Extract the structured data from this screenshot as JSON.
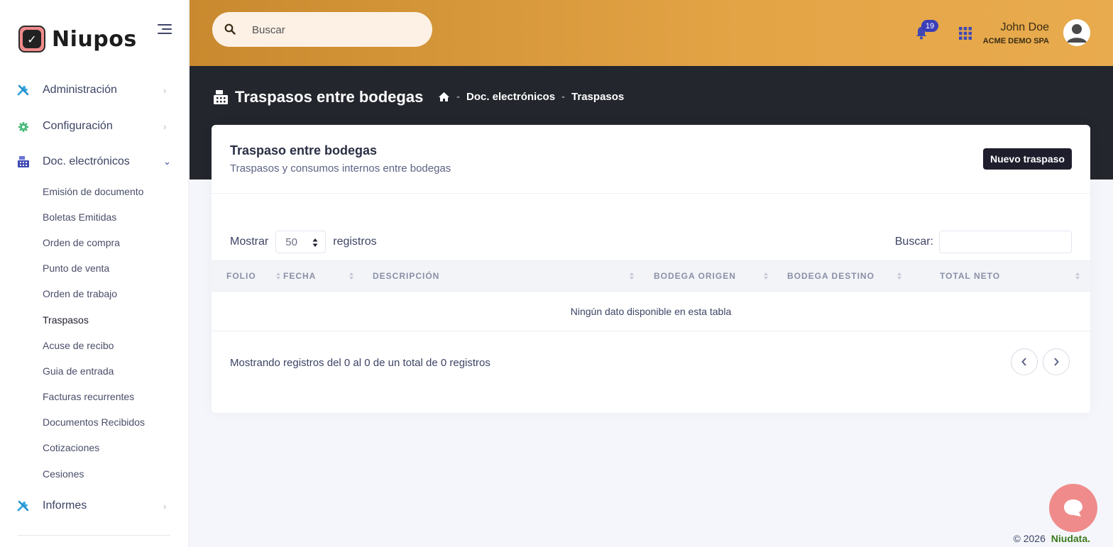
{
  "brand": {
    "name": "Niupos",
    "logo_glyph": "✓"
  },
  "sidebar": {
    "items": [
      {
        "label": "Administración",
        "icon": "tools-icon"
      },
      {
        "label": "Configuración",
        "icon": "gear-icon"
      },
      {
        "label": "Doc. electrónicos",
        "icon": "cash-register-icon"
      },
      {
        "label": "Informes",
        "icon": "tools-icon"
      }
    ],
    "sub_items": [
      "Emisión de documento",
      "Boletas Emitidas",
      "Orden de compra",
      "Punto de venta",
      "Orden de trabajo",
      "Traspasos",
      "Acuse de recibo",
      "Guia de entrada",
      "Facturas recurrentes",
      "Documentos Recibidos",
      "Cotizaciones",
      "Cesiones"
    ],
    "active_sub_item": "Traspasos"
  },
  "header": {
    "search_placeholder": "Buscar",
    "notification_count": "19",
    "user_name": "John Doe",
    "user_company": "ACME DEMO SPA",
    "accent_color": "#e3a446"
  },
  "page": {
    "title": "Traspasos entre bodegas",
    "breadcrumb": [
      "Doc. electrónicos",
      "Traspasos"
    ],
    "breadcrumb_separator": "-"
  },
  "card": {
    "title": "Traspaso entre bodegas",
    "subtitle": "Traspasos y consumos internos entre bodegas",
    "new_button": "Nuevo traspaso"
  },
  "table": {
    "length_prefix": "Mostrar",
    "length_value": "50",
    "length_suffix": "registros",
    "search_label": "Buscar:",
    "columns": [
      "FOLIO",
      "FECHA",
      "DESCRIPCIÓN",
      "BODEGA ORIGEN",
      "BODEGA DESTINO",
      "TOTAL NETO"
    ],
    "empty_message": "Ningún dato disponible en esta tabla",
    "info": "Mostrando registros del 0 al 0 de un total de 0 registros"
  },
  "footer": {
    "copyright": "© 2026",
    "brand": "Niudata."
  }
}
